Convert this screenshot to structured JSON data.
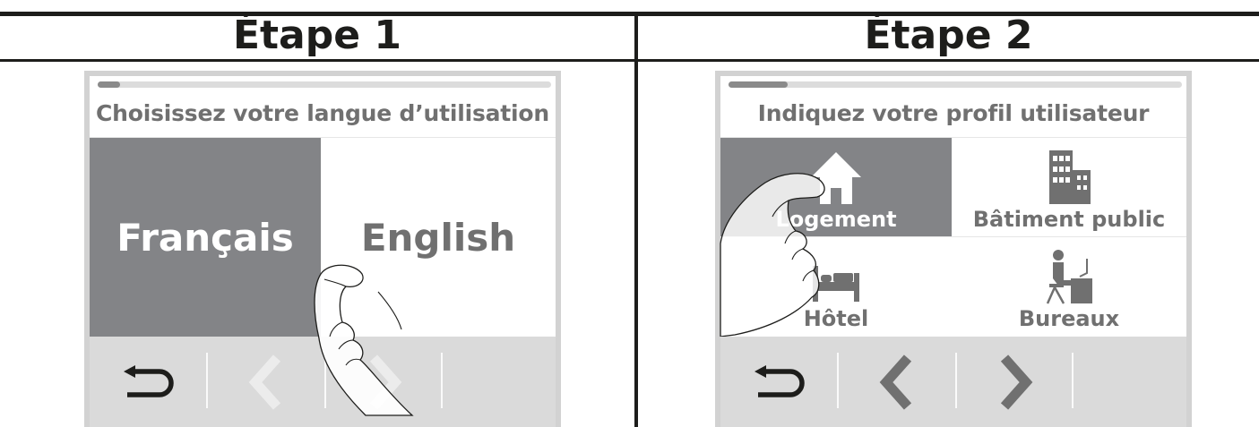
{
  "steps": [
    {
      "title": "Étape 1",
      "screen": {
        "progress": 0.05,
        "prompt": "Choisissez votre langue d’utilisation",
        "languages": [
          {
            "label": "Français",
            "selected": true
          },
          {
            "label": "English",
            "selected": false
          }
        ],
        "toolbar": [
          "back-icon",
          "chevron-left-icon",
          "chevron-right-icon"
        ]
      }
    },
    {
      "title": "Étape 2",
      "screen": {
        "progress": 0.13,
        "prompt": "Indiquez votre profil utilisateur",
        "profiles": [
          {
            "label": "Logement",
            "icon": "house-icon",
            "selected": true
          },
          {
            "label": "Bâtiment public",
            "icon": "building-icon",
            "selected": false
          },
          {
            "label": "Hôtel",
            "icon": "bed-icon",
            "selected": false
          },
          {
            "label": "Bureaux",
            "icon": "office-worker-icon",
            "selected": false
          }
        ],
        "toolbar": [
          "back-icon",
          "chevron-left-icon",
          "chevron-right-icon"
        ]
      }
    }
  ],
  "colors": {
    "selected": "#838487",
    "text_grey": "#707070",
    "toolbar_bg": "#dadada",
    "frame": "#d2d2d2",
    "rule": "#1d1d1b"
  }
}
